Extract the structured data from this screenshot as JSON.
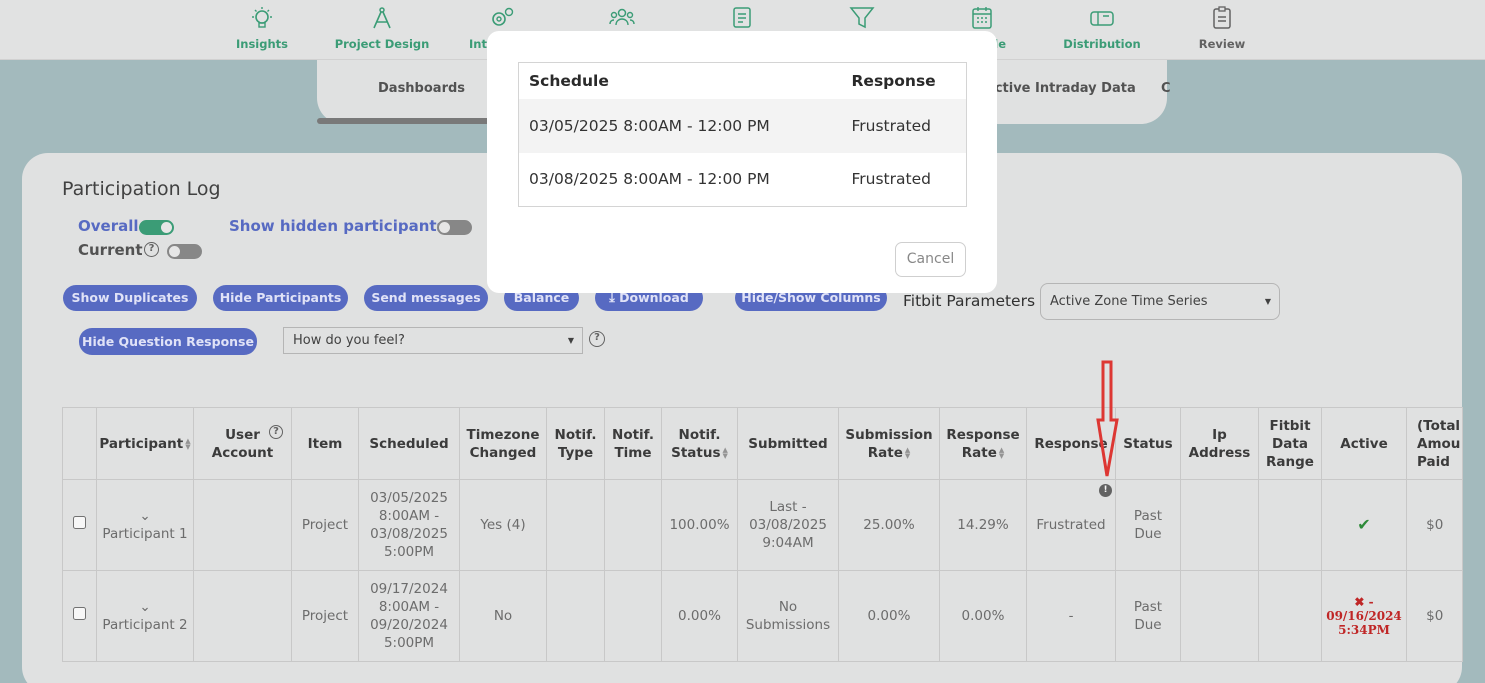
{
  "nav": {
    "items": [
      {
        "label": "Insights",
        "icon": "lightbulb-icon"
      },
      {
        "label": "Project Design",
        "icon": "compass-icon"
      },
      {
        "label": "Int",
        "icon": "gears-icon"
      },
      {
        "label": "",
        "icon": "users-icon"
      },
      {
        "label": "",
        "icon": "document-icon"
      },
      {
        "label": "",
        "icon": "filter-icon"
      },
      {
        "label": "le",
        "icon": "calendar-icon"
      },
      {
        "label": "Distribution",
        "icon": "mailbox-icon"
      },
      {
        "label": "Review",
        "icon": "clipboard-icon"
      }
    ]
  },
  "subnav": {
    "dashboards": "Dashboards",
    "intraday": "ective Intraday Data",
    "cut": "C"
  },
  "log": {
    "title": "Participation Log",
    "overall": "Overall",
    "current": "Current",
    "show_hidden": "Show hidden participants",
    "buttons": {
      "show_duplicates": "Show Duplicates",
      "hide_participants": "Hide Participants",
      "send_messages": "Send messages",
      "balance": "Balance",
      "download": "Download",
      "hide_show_columns": "Hide/Show Columns",
      "hide_question_response": "Hide Question Response"
    },
    "fitbit_label": "Fitbit Parameters",
    "fitbit_value": "Active Zone Time Series",
    "question_value": "How do you feel?"
  },
  "table": {
    "headers": {
      "participant": "Participant",
      "user_account_1": "User",
      "user_account_2": "Account",
      "item": "Item",
      "scheduled": "Scheduled",
      "tz_1": "Timezone",
      "tz_2": "Changed",
      "ntype_1": "Notif.",
      "ntype_2": "Type",
      "ntime_1": "Notif.",
      "ntime_2": "Time",
      "nstatus_1": "Notif.",
      "nstatus_2": "Status",
      "submitted": "Submitted",
      "subrate_1": "Submission",
      "subrate_2": "Rate",
      "resprate_1": "Response",
      "resprate_2": "Rate",
      "response": "Response",
      "status": "Status",
      "ip_1": "Ip",
      "ip_2": "Address",
      "fitbit_1": "Fitbit",
      "fitbit_2": "Data",
      "fitbit_3": "Range",
      "active": "Active",
      "total_1": "(Total",
      "total_2": "Amou",
      "total_3": "Paid"
    },
    "rows": [
      {
        "participant": "Participant 1",
        "item": "Project",
        "sched_1": "03/05/2025",
        "sched_2": "8:00AM -",
        "sched_3": "03/08/2025",
        "sched_4": "5:00PM",
        "tz": "Yes (4)",
        "nstatus": "100.00%",
        "sub_1": "Last -",
        "sub_2": "03/08/2025",
        "sub_3": "9:04AM",
        "subrate": "25.00%",
        "resprate": "14.29%",
        "response": "Frustrated",
        "status_1": "Past",
        "status_2": "Due",
        "paid": "$0"
      },
      {
        "participant": "Participant 2",
        "item": "Project",
        "sched_1": "09/17/2024",
        "sched_2": "8:00AM -",
        "sched_3": "09/20/2024",
        "sched_4": "5:00PM",
        "tz": "No",
        "nstatus": "0.00%",
        "sub_1": "No",
        "sub_2": "Submissions",
        "subrate": "0.00%",
        "resprate": "0.00%",
        "response": "-",
        "status_1": "Past",
        "status_2": "Due",
        "inactive_1": "-",
        "inactive_2": "09/16/2024",
        "inactive_3": "5:34PM",
        "paid": "$0"
      }
    ]
  },
  "modal": {
    "col_schedule": "Schedule",
    "col_response": "Response",
    "rows": [
      {
        "schedule": "03/05/2025 8:00AM - 12:00 PM",
        "response": "Frustrated"
      },
      {
        "schedule": "03/08/2025 8:00AM - 12:00 PM",
        "response": "Frustrated"
      }
    ],
    "cancel": "Cancel"
  },
  "colors": {
    "accent": "#5a6ec9",
    "green": "#3da27a",
    "arrow": "#e53935"
  }
}
